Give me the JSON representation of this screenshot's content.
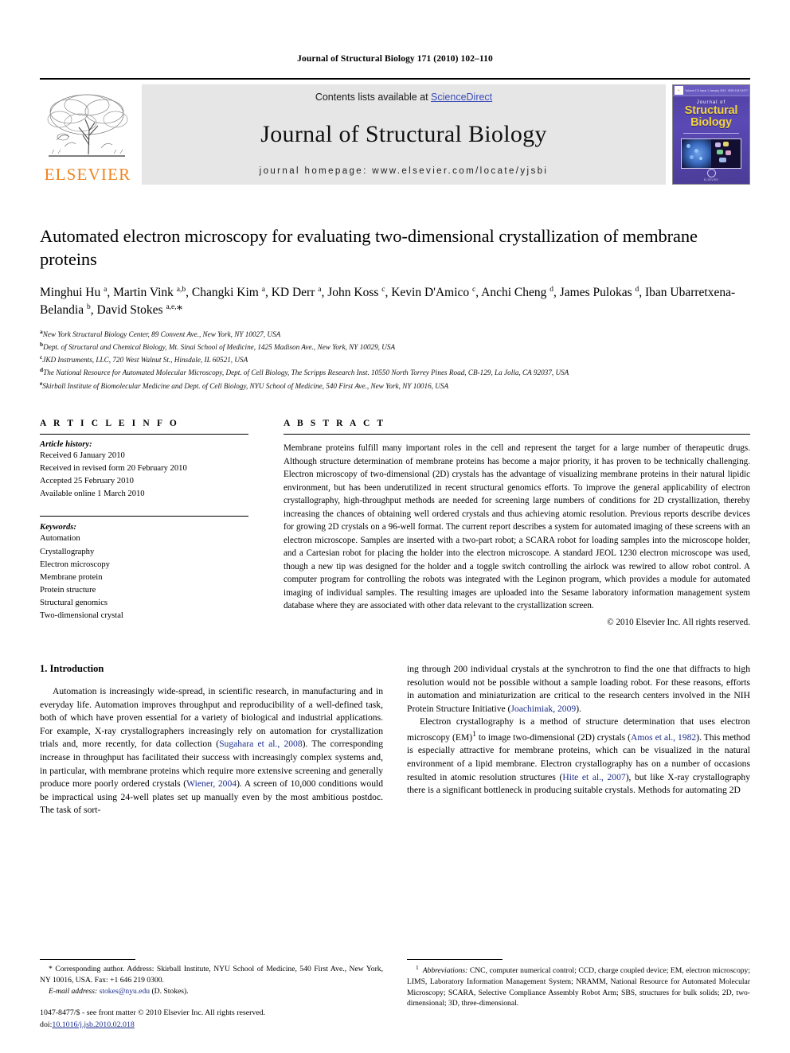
{
  "running_head": "Journal of Structural Biology 171 (2010) 102–110",
  "masthead": {
    "publisher_name": "ELSEVIER",
    "contents_prefix": "Contents lists available at ",
    "sciencedirect": "ScienceDirect",
    "journal_name": "Journal of Structural Biology",
    "homepage": "journal homepage: www.elsevier.com/locate/yjsbi",
    "link_color": "#3b4cb8",
    "elsevier_orange": "#F08522",
    "cover": {
      "kicker": "Journal of",
      "line1": "Structural",
      "line2": "Biology",
      "topbar_left": "Volume 171 Issue 1 January 2010",
      "topbar_right": "ISSN 1047-8477",
      "seal_text": "ELSEVIER",
      "bg_color": "#4e3f9e",
      "title_color": "#F2D43C"
    }
  },
  "title": "Automated electron microscopy for evaluating two-dimensional crystallization of membrane proteins",
  "authors_html": "Minghui Hu <sup>a</sup>, Martin Vink <sup>a,b</sup>, Changki Kim <sup>a</sup>, KD Derr <sup>a</sup>, John Koss <sup>c</sup>, Kevin D'Amico <sup>c</sup>, Anchi Cheng <sup>d</sup>, James Pulokas <sup>d</sup>, Iban Ubarretxena-Belandia <sup>b</sup>, David Stokes <sup>a,e,</sup>*",
  "affiliations": [
    {
      "mark": "a",
      "text": "New York Structural Biology Center, 89 Convent Ave., New York, NY 10027, USA"
    },
    {
      "mark": "b",
      "text": "Dept. of Structural and Chemical Biology, Mt. Sinai School of Medicine, 1425 Madison Ave., New York, NY 10029, USA"
    },
    {
      "mark": "c",
      "text": "JKD Instruments, LLC, 720 West Walnut St., Hinsdale, IL 60521, USA"
    },
    {
      "mark": "d",
      "text": "The National Resource for Automated Molecular Microscopy, Dept. of Cell Biology, The Scripps Research Inst. 10550 North Torrey Pines Road, CB-129, La Jolla, CA 92037, USA"
    },
    {
      "mark": "e",
      "text": "Skirball Institute of Biomolecular Medicine and Dept. of Cell Biology, NYU School of Medicine, 540 First Ave., New York, NY 10016, USA"
    }
  ],
  "article_info": {
    "label": "A R T I C L E    I N F O",
    "history_head": "Article history:",
    "history": [
      "Received 6 January 2010",
      "Received in revised form 20 February 2010",
      "Accepted 25 February 2010",
      "Available online 1 March 2010"
    ],
    "keywords_head": "Keywords:",
    "keywords": [
      "Automation",
      "Crystallography",
      "Electron microscopy",
      "Membrane protein",
      "Protein structure",
      "Structural genomics",
      "Two-dimensional crystal"
    ]
  },
  "abstract": {
    "label": "A B S T R A C T",
    "text": "Membrane proteins fulfill many important roles in the cell and represent the target for a large number of therapeutic drugs. Although structure determination of membrane proteins has become a major priority, it has proven to be technically challenging. Electron microscopy of two-dimensional (2D) crystals has the advantage of visualizing membrane proteins in their natural lipidic environment, but has been underutilized in recent structural genomics efforts. To improve the general applicability of electron crystallography, high-throughput methods are needed for screening large numbers of conditions for 2D crystallization, thereby increasing the chances of obtaining well ordered crystals and thus achieving atomic resolution. Previous reports describe devices for growing 2D crystals on a 96-well format. The current report describes a system for automated imaging of these screens with an electron microscope. Samples are inserted with a two-part robot; a SCARA robot for loading samples into the microscope holder, and a Cartesian robot for placing the holder into the electron microscope. A standard JEOL 1230 electron microscope was used, though a new tip was designed for the holder and a toggle switch controlling the airlock was rewired to allow robot control. A computer program for controlling the robots was integrated with the Leginon program, which provides a module for automated imaging of individual samples. The resulting images are uploaded into the Sesame laboratory information management system database where they are associated with other data relevant to the crystallization screen.",
    "copyright": "© 2010 Elsevier Inc. All rights reserved."
  },
  "section": {
    "heading": "1. Introduction",
    "left_paragraph_html": "Automation is increasingly wide-spread, in scientific research, in manufacturing and in everyday life. Automation improves throughput and reproducibility of a well-defined task, both of which have proven essential for a variety of biological and industrial applications. For example, X-ray crystallographers increasingly rely on automation for crystallization trials and, more recently, for data collection (<span class=\"cite\">Sugahara et al., 2008</span>). The corresponding increase in throughput has facilitated their success with increasingly complex systems and, in particular, with membrane proteins which require more extensive screening and generally produce more poorly ordered crystals (<span class=\"cite\">Wiener, 2004</span>). A screen of 10,000 conditions would be impractical using 24-well plates set up manually even by the most ambitious postdoc. The task of sort-",
    "right_paragraph1_html": "ing through 200 individual crystals at the synchrotron to find the one that diffracts to high resolution would not be possible without a sample loading robot. For these reasons, efforts in automation and miniaturization are critical to the research centers involved in the NIH Protein Structure Initiative (<span class=\"cite\">Joachimiak, 2009</span>).",
    "right_paragraph2_html": "Electron crystallography is a method of structure determination that uses electron microscopy (EM)<sup>1</sup> to image two-dimensional (2D) crystals (<span class=\"cite\">Amos et al., 1982</span>). This method is especially attractive for membrane proteins, which can be visualized in the natural environment of a lipid membrane. Electron crystallography has on a number of occasions resulted in atomic resolution structures (<span class=\"cite\">Hite et al., 2007</span>), but like X-ray crystallography there is a significant bottleneck in producing suitable crystals. Methods for automating 2D"
  },
  "footnotes": {
    "corresponding_html": "* Corresponding author. Address: Skirball Institute, NYU School of Medicine, 540 First Ave., New York, NY 10016, USA. Fax: +1 646 219 0300.",
    "email_html": "<span class=\"ital\">E-mail address:</span> <span class=\"link\">stokes@nyu.edu</span> (D. Stokes).",
    "abbrev_html": "<sup>1</sup> &nbsp;<span class=\"ital\">Abbreviations:</span> CNC, computer numerical control; CCD, charge coupled device; EM, electron microscopy; LIMS, Laboratory Information Management System; NRAMM, National Resource for Automated Molecular Microscopy; SCARA, Selective Compliance Assembly Robot Arm; SBS, structures for bulk solids; 2D, two-dimensional; 3D, three-dimensional.",
    "issn_line": "1047-8477/$ - see front matter © 2010 Elsevier Inc. All rights reserved.",
    "doi_prefix": "doi:",
    "doi": "10.1016/j.jsb.2010.02.018"
  }
}
